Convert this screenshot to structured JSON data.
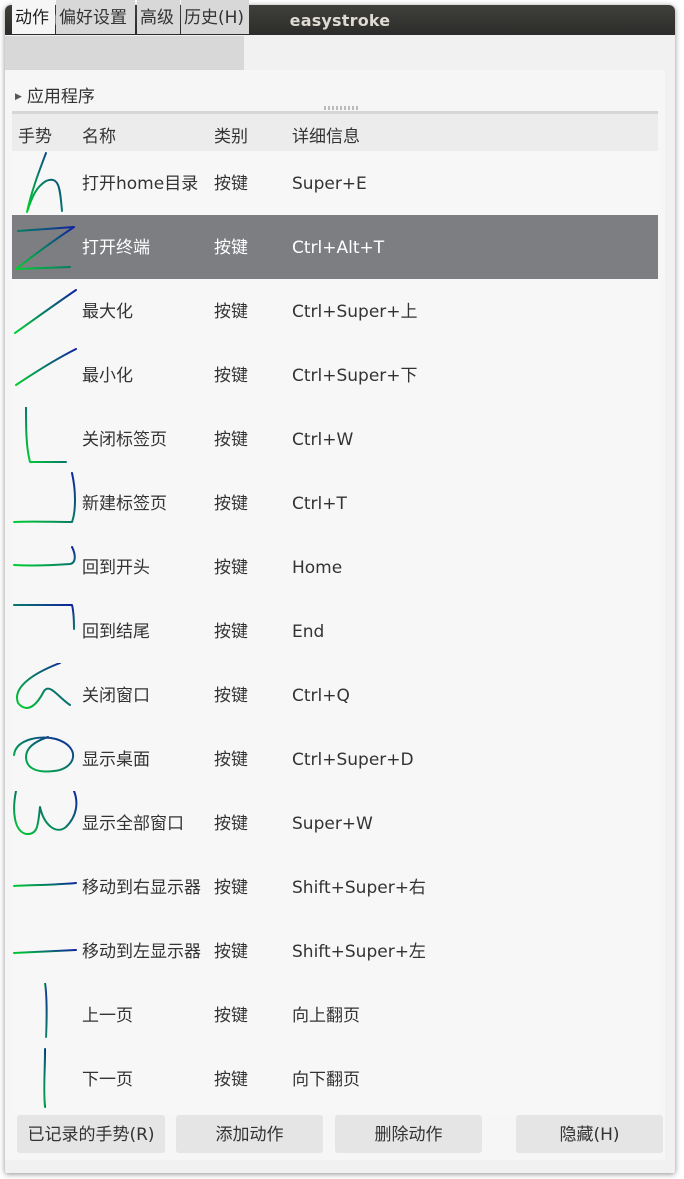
{
  "window": {
    "title": "easystroke"
  },
  "tabs": [
    {
      "label": "动作"
    },
    {
      "label": "偏好设置"
    },
    {
      "label": "高级"
    },
    {
      "label": "历史(H)"
    }
  ],
  "apps_expander": {
    "label": "应用程序",
    "icon": "expander-arrow-right"
  },
  "columns": {
    "gesture": "手势",
    "name": "名称",
    "type": "类别",
    "detail": "详细信息"
  },
  "rows": [
    {
      "gesture_icon": "stroke-h-icon",
      "name": "打开home目录",
      "type": "按键",
      "detail": "Super+E"
    },
    {
      "gesture_icon": "stroke-z-icon",
      "name": "打开终端",
      "type": "按键",
      "detail": "Ctrl+Alt+T",
      "selected": true
    },
    {
      "gesture_icon": "stroke-diagonal-up-icon",
      "name": "最大化",
      "type": "按键",
      "detail": "Ctrl+Super+上"
    },
    {
      "gesture_icon": "stroke-slant-up-icon",
      "name": "最小化",
      "type": "按键",
      "detail": "Ctrl+Super+下"
    },
    {
      "gesture_icon": "stroke-l-icon",
      "name": "关闭标签页",
      "type": "按键",
      "detail": "Ctrl+W"
    },
    {
      "gesture_icon": "stroke-j-icon",
      "name": "新建标签页",
      "type": "按键",
      "detail": "Ctrl+T"
    },
    {
      "gesture_icon": "stroke-hook-right-icon",
      "name": "回到开头",
      "type": "按键",
      "detail": "Home"
    },
    {
      "gesture_icon": "stroke-seven-icon",
      "name": "回到结尾",
      "type": "按键",
      "detail": "End"
    },
    {
      "gesture_icon": "stroke-alpha-icon",
      "name": "关闭窗口",
      "type": "按键",
      "detail": "Ctrl+Q"
    },
    {
      "gesture_icon": "stroke-loop-icon",
      "name": "显示桌面",
      "type": "按键",
      "detail": "Ctrl+Super+D"
    },
    {
      "gesture_icon": "stroke-w-icon",
      "name": "显示全部窗口",
      "type": "按键",
      "detail": "Super+W"
    },
    {
      "gesture_icon": "stroke-right-icon",
      "name": "移动到右显示器",
      "type": "按键",
      "detail": "Shift+Super+右"
    },
    {
      "gesture_icon": "stroke-left-icon",
      "name": "移动到左显示器",
      "type": "按键",
      "detail": "Shift+Super+左"
    },
    {
      "gesture_icon": "stroke-down-icon",
      "name": "上一页",
      "type": "按键",
      "detail": "向上翻页"
    },
    {
      "gesture_icon": "stroke-up-icon",
      "name": "下一页",
      "type": "按键",
      "detail": "向下翻页"
    }
  ],
  "buttons": {
    "recorded": "已记录的手势(R)",
    "add": "添加动作",
    "delete": "删除动作",
    "hide": "隐藏(H)"
  },
  "colors": {
    "stroke_start": "#00d030",
    "stroke_end": "#1020a0",
    "selected_row": "#7d7e82"
  }
}
